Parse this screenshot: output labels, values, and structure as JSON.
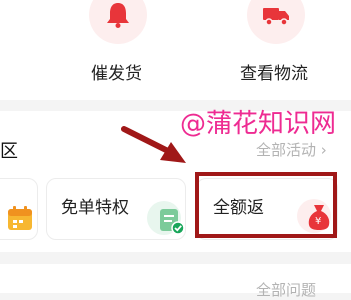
{
  "order_actions": [
    {
      "label": "催发货",
      "icon": "bell-icon"
    },
    {
      "label": "查看物流",
      "icon": "truck-icon"
    }
  ],
  "section": {
    "title_partial": "区",
    "all_link": "全部活动"
  },
  "cards": [
    {
      "label": "免单特权",
      "icon": "document-check-icon"
    },
    {
      "label": "全额返",
      "icon": "money-bag-icon",
      "icon_text": "¥"
    }
  ],
  "watermark": "@蒲花知识网",
  "bottom": {
    "all_link_partial": "全部问题"
  },
  "colors": {
    "accent": "#e8353a",
    "annotation": "#a01818",
    "watermark": "#ee2b92"
  }
}
